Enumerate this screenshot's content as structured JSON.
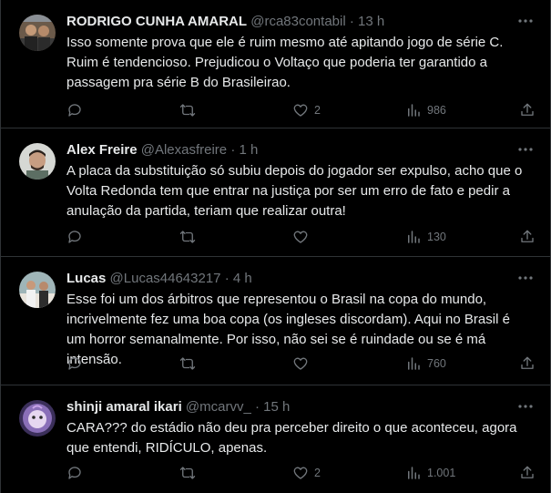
{
  "tweets": [
    {
      "name": "RODRIGO CUNHA AMARAL",
      "handle": "@rca83contabil",
      "separator": "·",
      "time": "13 h",
      "text": "Isso somente prova que ele é ruim mesmo até apitando jogo de série C. Ruim é tendencioso. Prejudicou o Voltaço que poderia ter garantido a passagem pra série B do Brasileirao.",
      "replies": "",
      "retweets": "",
      "likes": "2",
      "views": "986"
    },
    {
      "name": "Alex Freire",
      "handle": "@Alexasfreire",
      "separator": "·",
      "time": "1 h",
      "text": "A placa da substituição só subiu depois do jogador ser expulso, acho que o Volta Redonda tem que entrar na justiça por ser um erro de fato e pedir a anulação da partida, teriam que realizar outra!",
      "replies": "",
      "retweets": "",
      "likes": "",
      "views": "130"
    },
    {
      "name": "Lucas",
      "handle": "@Lucas44643217",
      "separator": "·",
      "time": "4 h",
      "text": "Esse foi um dos árbitros que representou o Brasil na copa do mundo, incrivelmente fez uma boa copa (os ingleses discordam). Aqui no Brasil é um horror semanalmente. Por isso, não sei se é ruindade ou se é má intensão.",
      "replies": "",
      "retweets": "",
      "likes": "",
      "views": "760"
    },
    {
      "name": "shinji amaral ikari",
      "handle": "@mcarvv_",
      "separator": "·",
      "time": "15 h",
      "text": "CARA??? do estádio não deu pra perceber direito o que aconteceu, agora que entendi, RIDÍCULO, apenas.",
      "replies": "",
      "retweets": "",
      "likes": "2",
      "views": "1.001"
    }
  ],
  "icons": {
    "more": "more-horizontal-icon",
    "reply": "reply-icon",
    "retweet": "retweet-icon",
    "like": "heart-icon",
    "views": "views-bar-chart-icon",
    "share": "share-icon"
  },
  "colors": {
    "background": "#000000",
    "text": "#e7e9ea",
    "secondary": "#71767b",
    "divider": "#2f3336"
  }
}
